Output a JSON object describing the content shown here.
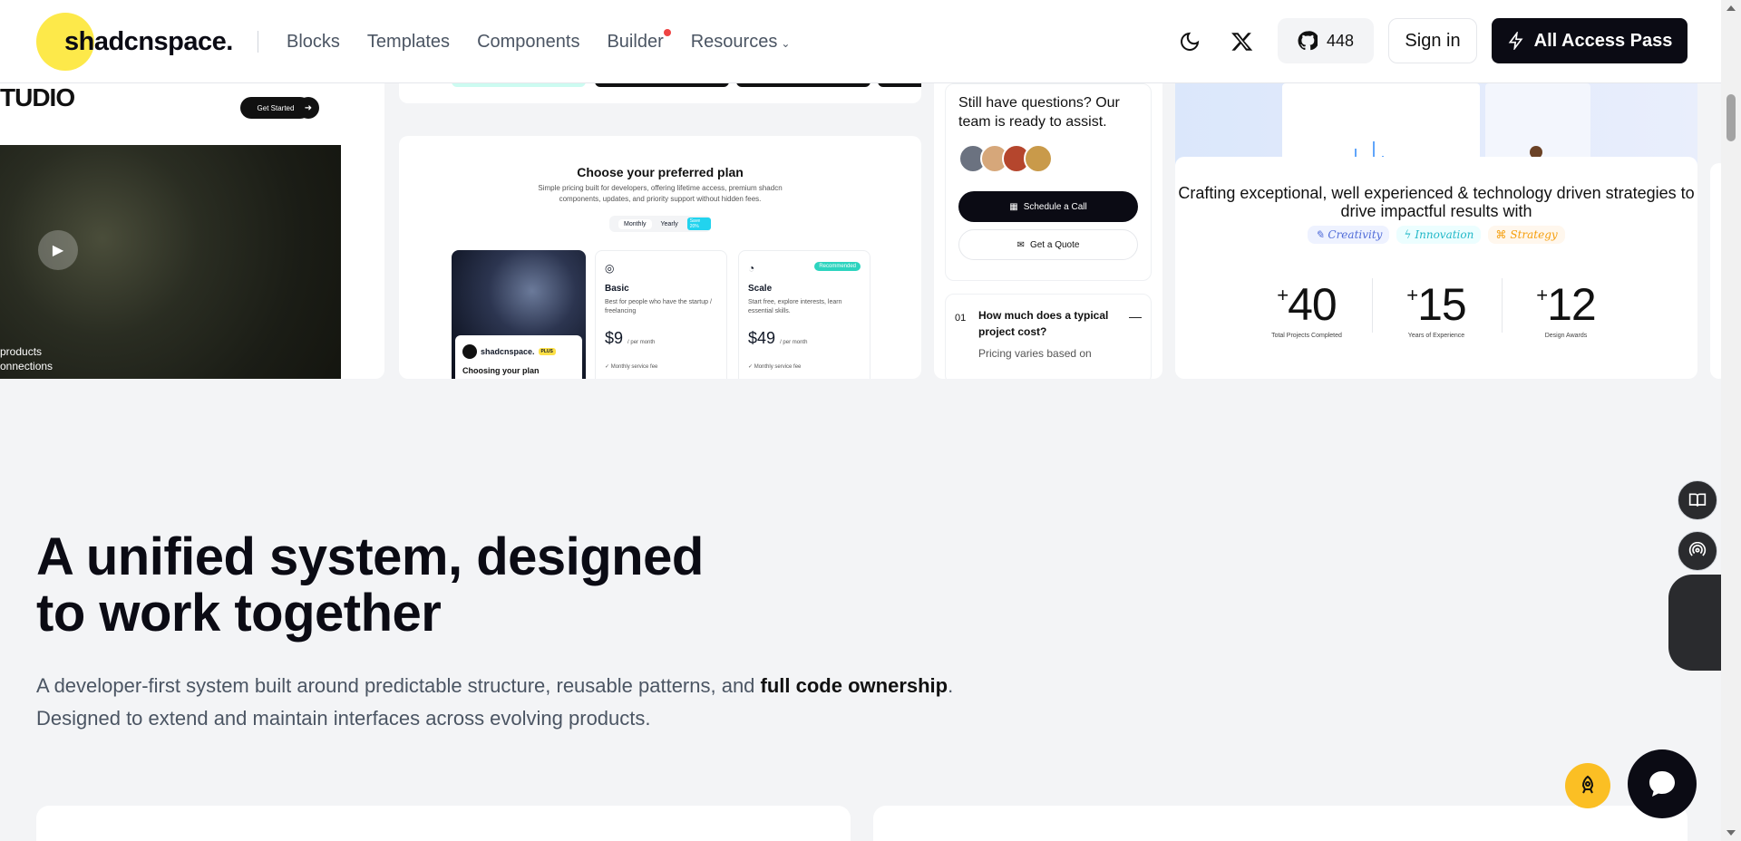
{
  "header": {
    "logo": "shadcnspace.",
    "nav": [
      {
        "label": "Blocks"
      },
      {
        "label": "Templates"
      },
      {
        "label": "Components"
      },
      {
        "label": "Builder"
      },
      {
        "label": "Resources"
      }
    ],
    "github_stars": "448",
    "sign_in": "Sign in",
    "cta": "All Access Pass"
  },
  "gallery": {
    "studio": {
      "title": "TUDIO",
      "button": "Get Started",
      "caption_line1": "products",
      "caption_line2": "onnections"
    },
    "pricing": {
      "title": "Choose your preferred plan",
      "subtitle": "Simple pricing built for developers, offering lifetime access, premium shadcn components, updates, and priority support without hidden fees.",
      "toggle_monthly": "Monthly",
      "toggle_yearly": "Yearly",
      "yearly_badge": "Save 20%",
      "image_brand": "shadcnspace.",
      "image_badge": "PLUS",
      "image_line": "Choosing your plan",
      "plans": [
        {
          "name": "Basic",
          "desc": "Best for people who have the startup / freelancing",
          "price": "$9",
          "period": "/ per month",
          "feature": "Monthly service fee"
        },
        {
          "name": "Scale",
          "desc": "Start free, explore interests, learn essential skills.",
          "price": "$49",
          "period": "/ per month",
          "feature": "Monthly service fee",
          "badge": "Recommended"
        }
      ]
    },
    "faq": {
      "question": "Still have questions? Our team is ready to assist.",
      "schedule": "Schedule a Call",
      "quote": "Get a Quote",
      "item_num": "01",
      "item_title": "How much does a typical project cost?",
      "item_answer": "Pricing varies based on"
    },
    "stats": {
      "title": "Crafting exceptional, well experienced & technology driven strategies to drive impactful results with",
      "chips": [
        "Creativity",
        "Innovation",
        "Strategy"
      ],
      "items": [
        {
          "value": "40",
          "label": "Total Projects Completed"
        },
        {
          "value": "15",
          "label": "Years of Experience"
        },
        {
          "value": "12",
          "label": "Design Awards"
        }
      ]
    }
  },
  "section": {
    "headline_line1": "A unified system, designed",
    "headline_line2": "to work together",
    "desc_part1": "A developer-first system built around predictable structure, reusable patterns, and ",
    "desc_strong": "full code ownership",
    "desc_part2": ".",
    "desc_line2": "Designed to extend and maintain interfaces across evolving products."
  },
  "colors": {
    "accent": "#fde94a",
    "dark": "#0b0b14",
    "bg": "#f3f4f6",
    "notify": "#ef4444"
  },
  "icons": [
    "moon-icon",
    "x-icon",
    "github-icon",
    "bolt-icon",
    "book-icon",
    "podcast-icon",
    "grid-icon",
    "bot-icon",
    "rocket-icon",
    "chat-icon",
    "play-icon"
  ]
}
